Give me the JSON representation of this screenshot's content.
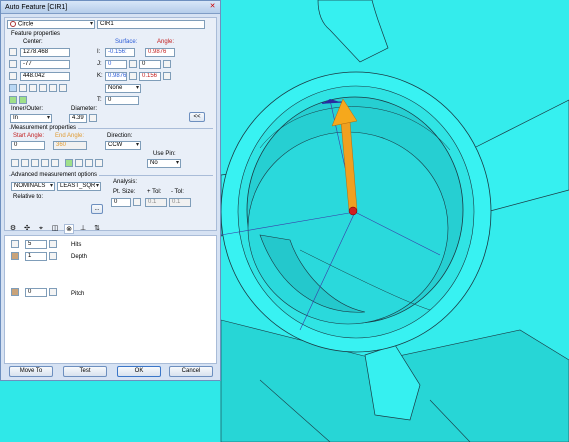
{
  "window": {
    "title": "Auto Feature [CIR1]"
  },
  "header": {
    "feature_type": "Circle",
    "feature_id": "CIR1"
  },
  "feature_properties": {
    "heading": "Feature properties",
    "center_label": "Center:",
    "surface_label": "Surface:",
    "angle_label": "Angle:",
    "x": "1278.468",
    "y": "-77",
    "z": "448.042",
    "i_label": "I:",
    "j_label": "J:",
    "k_label": "K:",
    "t_label": "T:",
    "i_surface": "-0.156:",
    "j_surface": "0",
    "k_surface": "0.9876",
    "i_angle": "0.9876",
    "j_angle": "0",
    "k_angle": "0.156",
    "none_option": "None",
    "t_value": "0",
    "inner_outer_label": "Inner/Outer:",
    "inner_outer_value": "In",
    "diameter_label": "Diameter:",
    "diameter_value": "4.39",
    "collapse_label": "<<"
  },
  "measurement_properties": {
    "heading": "Measurement properties",
    "start_angle_label": "Start Angle:",
    "end_angle_label": "End Angle:",
    "direction_label": "Direction:",
    "start_angle": "0",
    "end_angle": "360",
    "direction": "CCW",
    "use_pin_label": "Use Pin:",
    "use_pin": "No"
  },
  "advanced": {
    "heading": "Advanced measurement options",
    "nominals": "NOMINALS",
    "fit": "LEAST_SQR",
    "relative_to_label": "Relative to:",
    "browse_label": "...",
    "analysis_label": "Analysis:",
    "pt_size_label": "Pt. Size:",
    "plus_tol_label": "+ Tol:",
    "minus_tol_label": "- Tol:",
    "pt_size": "0",
    "plus_tol": "0.1",
    "minus_tol": "0.1"
  },
  "hits_panel": {
    "hits_value": "5",
    "hits_label": "Hits",
    "depth_value": "1",
    "depth_label": "Depth",
    "pitch_value": "0",
    "pitch_label": "Pitch"
  },
  "footer": {
    "move_to": "Move To",
    "test": "Test",
    "ok": "OK",
    "cancel": "Cancel"
  },
  "colors": {
    "part": "#2fe8e8",
    "edge": "#1a3a44",
    "arrow": "#f0a020",
    "probe": "#d02020"
  },
  "icons": [
    "settings-icon",
    "probe-icon",
    "path-icon",
    "contact-icon",
    "hits-icon",
    "execution-icon",
    "sampling-icon"
  ]
}
